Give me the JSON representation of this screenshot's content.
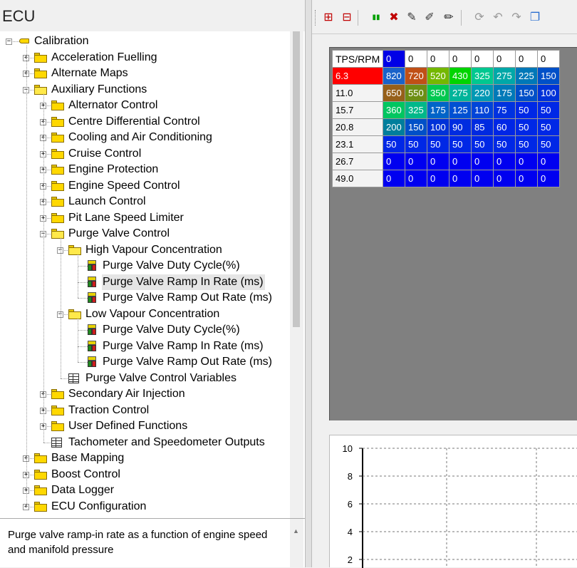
{
  "app_title": "ECU",
  "tree": {
    "items": [
      {
        "label": "Calibration",
        "level": 0,
        "icon": "calibration-icon",
        "expander": "minus"
      },
      {
        "label": "Acceleration Fuelling",
        "level": 1,
        "icon": "folder-icon",
        "expander": "plus"
      },
      {
        "label": "Alternate Maps",
        "level": 1,
        "icon": "folder-icon",
        "expander": "plus"
      },
      {
        "label": "Auxiliary Functions",
        "level": 1,
        "icon": "folder-open-icon",
        "expander": "minus"
      },
      {
        "label": "Alternator Control",
        "level": 2,
        "icon": "folder-icon",
        "expander": "plus"
      },
      {
        "label": "Centre Differential Control",
        "level": 2,
        "icon": "folder-icon",
        "expander": "plus"
      },
      {
        "label": "Cooling and Air Conditioning",
        "level": 2,
        "icon": "folder-icon",
        "expander": "plus"
      },
      {
        "label": "Cruise Control",
        "level": 2,
        "icon": "folder-icon",
        "expander": "plus"
      },
      {
        "label": "Engine Protection",
        "level": 2,
        "icon": "folder-icon",
        "expander": "plus"
      },
      {
        "label": "Engine Speed Control",
        "level": 2,
        "icon": "folder-icon",
        "expander": "plus"
      },
      {
        "label": "Launch Control",
        "level": 2,
        "icon": "folder-icon",
        "expander": "plus"
      },
      {
        "label": "Pit Lane Speed Limiter",
        "level": 2,
        "icon": "folder-icon",
        "expander": "plus"
      },
      {
        "label": "Purge Valve Control",
        "level": 2,
        "icon": "folder-open-icon",
        "expander": "minus"
      },
      {
        "label": "High Vapour Concentration",
        "level": 3,
        "icon": "folder-open-icon",
        "expander": "minus"
      },
      {
        "label": "Purge Valve Duty Cycle(%)",
        "level": 4,
        "icon": "map-cube-icon",
        "expander": "none"
      },
      {
        "label": "Purge Valve Ramp In Rate (ms)",
        "level": 4,
        "icon": "map-cube-icon",
        "expander": "none",
        "selected": true
      },
      {
        "label": "Purge Valve Ramp Out Rate (ms)",
        "level": 4,
        "icon": "map-cube-icon",
        "expander": "none"
      },
      {
        "label": "Low Vapour Concentration",
        "level": 3,
        "icon": "folder-open-icon",
        "expander": "minus"
      },
      {
        "label": "Purge Valve Duty Cycle(%)",
        "level": 4,
        "icon": "map-cube-icon",
        "expander": "none"
      },
      {
        "label": "Purge Valve Ramp In Rate (ms)",
        "level": 4,
        "icon": "map-cube-icon",
        "expander": "none"
      },
      {
        "label": "Purge Valve Ramp Out Rate (ms)",
        "level": 4,
        "icon": "map-cube-icon",
        "expander": "none"
      },
      {
        "label": "Purge Valve Control Variables",
        "level": 3,
        "icon": "table-icon",
        "expander": "none"
      },
      {
        "label": "Secondary Air Injection",
        "level": 2,
        "icon": "folder-icon",
        "expander": "plus"
      },
      {
        "label": "Traction Control",
        "level": 2,
        "icon": "folder-icon",
        "expander": "plus"
      },
      {
        "label": "User Defined Functions",
        "level": 2,
        "icon": "folder-icon",
        "expander": "plus"
      },
      {
        "label": "Tachometer and Speedometer Outputs",
        "level": 2,
        "icon": "table-icon",
        "expander": "none"
      },
      {
        "label": "Base Mapping",
        "level": 1,
        "icon": "folder-icon",
        "expander": "plus"
      },
      {
        "label": "Boost Control",
        "level": 1,
        "icon": "folder-icon",
        "expander": "plus"
      },
      {
        "label": "Data Logger",
        "level": 1,
        "icon": "folder-icon",
        "expander": "plus"
      },
      {
        "label": "ECU Configuration",
        "level": 1,
        "icon": "folder-icon",
        "expander": "plus"
      }
    ]
  },
  "description": "Purge valve ramp-in rate as a function of engine speed and manifold pressure",
  "toolbar": {
    "buttons": [
      {
        "name": "insert-row-icon",
        "glyph": "⊞",
        "color": "#c00000"
      },
      {
        "name": "delete-row-icon",
        "glyph": "⊟",
        "color": "#c00000"
      },
      {
        "name": "insert-column-icon",
        "glyph": "▮▮",
        "color": "#00a000"
      },
      {
        "name": "delete-column-icon",
        "glyph": "✖",
        "color": "#c00000"
      },
      {
        "name": "edit-axis-icon",
        "glyph": "✎",
        "color": "#333333"
      },
      {
        "name": "edit-values-icon",
        "glyph": "✐",
        "color": "#333333"
      },
      {
        "name": "pencil-icon",
        "glyph": "✏",
        "color": "#222222"
      },
      {
        "name": "refresh-icon",
        "glyph": "⟳",
        "color": "#9a9a9a"
      },
      {
        "name": "undo-icon",
        "glyph": "↶",
        "color": "#9a9a9a"
      },
      {
        "name": "redo-icon",
        "glyph": "↷",
        "color": "#9a9a9a"
      },
      {
        "name": "copy-icon",
        "glyph": "❐",
        "color": "#2a6fd0"
      }
    ]
  },
  "map_table": {
    "corner_label": "TPS/RPM",
    "rpm_axis": [
      "0",
      "0",
      "0",
      "0",
      "0",
      "0",
      "0",
      "0"
    ],
    "rows": [
      {
        "tps": "6.3",
        "values": [
          "820",
          "720",
          "520",
          "430",
          "325",
          "275",
          "225",
          "150"
        ]
      },
      {
        "tps": "11.0",
        "values": [
          "650",
          "550",
          "350",
          "275",
          "220",
          "175",
          "150",
          "100"
        ]
      },
      {
        "tps": "15.7",
        "values": [
          "360",
          "325",
          "175",
          "125",
          "110",
          "75",
          "50",
          "50"
        ]
      },
      {
        "tps": "20.8",
        "values": [
          "200",
          "150",
          "100",
          "90",
          "85",
          "60",
          "50",
          "50"
        ]
      },
      {
        "tps": "23.1",
        "values": [
          "50",
          "50",
          "50",
          "50",
          "50",
          "50",
          "50",
          "50"
        ]
      },
      {
        "tps": "26.7",
        "values": [
          "0",
          "0",
          "0",
          "0",
          "0",
          "0",
          "0",
          "0"
        ]
      },
      {
        "tps": "49.0",
        "values": [
          "0",
          "0",
          "0",
          "0",
          "0",
          "0",
          "0",
          "0"
        ]
      }
    ],
    "selected_rpm_index": 0,
    "selected_tps_index": 0,
    "cell_colors": [
      [
        "#1a62c9",
        "#c05016",
        "#74b800",
        "#00d400",
        "#00c890",
        "#00a8a8",
        "#0078b8",
        "#0050c8"
      ],
      [
        "#96601a",
        "#6c8e14",
        "#00c850",
        "#00b49a",
        "#0098b4",
        "#007ab8",
        "#0050c8",
        "#0032d8"
      ],
      [
        "#00c660",
        "#00b88a",
        "#0064c8",
        "#0050d2",
        "#0044d8",
        "#0032e0",
        "#0028e6",
        "#0028e6"
      ],
      [
        "#007e9c",
        "#0050c8",
        "#0032d8",
        "#002ce0",
        "#002ae0",
        "#0026e6",
        "#0028e6",
        "#0028e6"
      ],
      [
        "#0028e6",
        "#0028e6",
        "#0028e6",
        "#0028e6",
        "#0028e6",
        "#0028e6",
        "#0028e6",
        "#0028e6"
      ],
      [
        "#0000f0",
        "#0000f0",
        "#0000f0",
        "#0000f0",
        "#0000f0",
        "#0000f0",
        "#0000f0",
        "#0000f0"
      ],
      [
        "#0000f0",
        "#0000f0",
        "#0000f0",
        "#0000f0",
        "#0000f0",
        "#0000f0",
        "#0000f0",
        "#0000f0"
      ]
    ]
  },
  "graph": {
    "y_ticks": [
      "10",
      "8",
      "6",
      "4",
      "2"
    ]
  }
}
